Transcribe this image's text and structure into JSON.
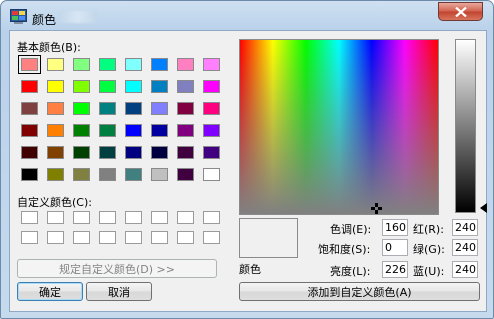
{
  "window": {
    "title": "颜色",
    "close_icon": "close-icon"
  },
  "basic_colors_label": "基本颜色(B):",
  "basic_colors": [
    [
      "#ff8080",
      "#ffff80",
      "#80ff80",
      "#00ff80",
      "#80ffff",
      "#0080ff",
      "#ff80c0",
      "#ff80ff"
    ],
    [
      "#ff0000",
      "#ffff00",
      "#80ff00",
      "#00ff40",
      "#00ffff",
      "#0080c0",
      "#8080c0",
      "#ff00ff"
    ],
    [
      "#804040",
      "#ff8040",
      "#00ff00",
      "#008080",
      "#004080",
      "#8080ff",
      "#800040",
      "#ff0080"
    ],
    [
      "#800000",
      "#ff8000",
      "#008000",
      "#008040",
      "#0000ff",
      "#0000a0",
      "#800080",
      "#8000ff"
    ],
    [
      "#400000",
      "#804000",
      "#004000",
      "#004040",
      "#000080",
      "#000040",
      "#400040",
      "#400080"
    ],
    [
      "#000000",
      "#808000",
      "#808040",
      "#808080",
      "#408080",
      "#c0c0c0",
      "#400040",
      "#ffffff"
    ]
  ],
  "custom_colors_label": "自定义颜色(C):",
  "define_custom_button": "规定自定义颜色(D) >>",
  "ok_button": "确定",
  "cancel_button": "取消",
  "color_solid_label": "颜色",
  "fields": {
    "hue_label": "色调(E):",
    "hue_value": "160",
    "sat_label": "饱和度(S):",
    "sat_value": "0",
    "lum_label": "亮度(L):",
    "lum_value": "226",
    "red_label": "红(R):",
    "red_value": "240",
    "green_label": "绿(G):",
    "green_value": "240",
    "blue_label": "蓝(U):",
    "blue_value": "240"
  },
  "add_custom_button": "添加到自定义颜色(A)"
}
